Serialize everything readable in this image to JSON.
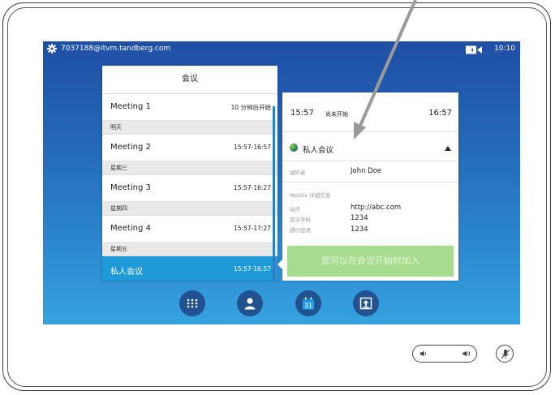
{
  "statusbar": {
    "sip_address": "7037188@itvm.tandberg.com",
    "clock": "10:10"
  },
  "meetings": {
    "title": "会议",
    "rows": [
      {
        "type": "meeting",
        "name": "Meeting 1",
        "time": "10 分钟后开始"
      },
      {
        "type": "header",
        "label": "明天"
      },
      {
        "type": "meeting",
        "name": "Meeting 2",
        "time": "15:57-16:57"
      },
      {
        "type": "header",
        "label": "星期三"
      },
      {
        "type": "meeting",
        "name": "Meeting 3",
        "time": "15:57-16:27"
      },
      {
        "type": "header",
        "label": "星期四"
      },
      {
        "type": "meeting",
        "name": "Meeting 4",
        "time": "15:57-17:27"
      },
      {
        "type": "header",
        "label": "星期五"
      },
      {
        "type": "meeting",
        "name": "私人会议",
        "time": "15:57-16:57",
        "selected": true
      }
    ]
  },
  "detail": {
    "start": "15:57",
    "status": "尚未开始",
    "end": "16:57",
    "title": "私人会议",
    "organizer_label": "组织者",
    "organizer": "John Doe",
    "webex_label": "WebEx 详细信息",
    "site_label": "站点",
    "site": "http://abc.com",
    "meeting_number_label": "会议号码",
    "meeting_number": "1234",
    "password_label": "通行密语",
    "password": "1234",
    "join_label": "您可以在会议开始时加入"
  },
  "dock": [
    "keypad-icon",
    "contacts-icon",
    "calendar-icon",
    "share-icon"
  ],
  "calendar_day": "31",
  "colors": {
    "selected_row": "#1e9ad8",
    "join_button": "#a6dc8d",
    "dock_button": "#21528f"
  }
}
